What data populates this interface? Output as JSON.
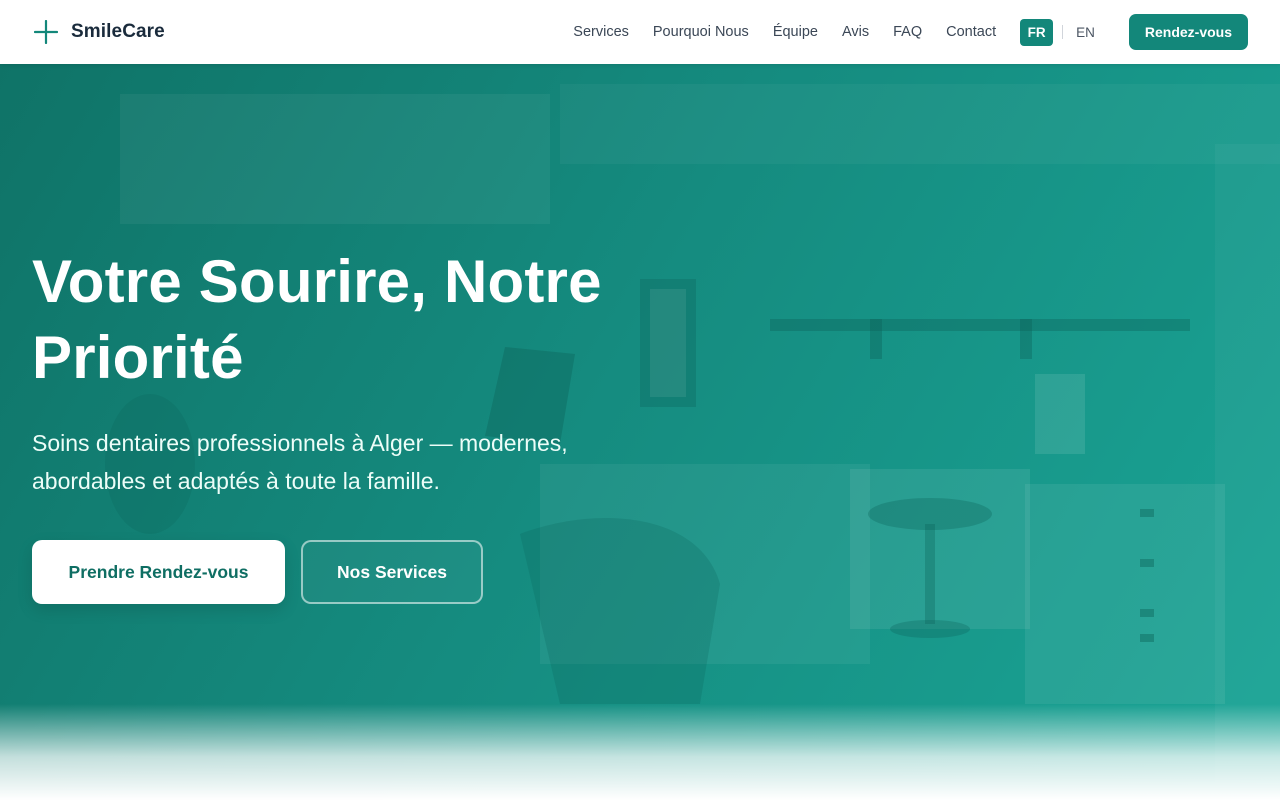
{
  "brand": {
    "name": "SmileCare",
    "icon": "plus-icon"
  },
  "nav": {
    "links": [
      "Services",
      "Pourquoi Nous",
      "Équipe",
      "Avis",
      "FAQ",
      "Contact"
    ],
    "languages": {
      "active": "FR",
      "inactive": "EN"
    },
    "cta_label": "Rendez-vous"
  },
  "hero": {
    "title_line1": "Votre Sourire, Notre",
    "title_line2": "Priorité",
    "subtitle_line1": "Soins dentaires professionnels à Alger — modernes,",
    "subtitle_line2": "abordables et adaptés à toute la famille.",
    "primary_button": "Prendre Rendez-vous",
    "secondary_button": "Nos Services"
  },
  "colors": {
    "accent": "#13877a",
    "hero_dark": "#0f7367",
    "hero_light": "#1aa596",
    "text_dark": "#1a2b3c"
  }
}
